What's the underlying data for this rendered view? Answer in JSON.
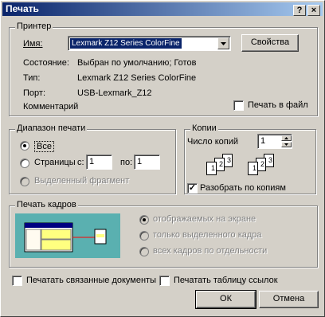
{
  "window": {
    "title": "Печать",
    "help_btn": "?",
    "close_btn": "×"
  },
  "printer": {
    "legend": "Принтер",
    "name_label": "Имя:",
    "name_value": "Lexmark Z12 Series ColorFine",
    "properties_btn": "Свойства",
    "status_label": "Состояние:",
    "status_value": "Выбран по умолчанию; Готов",
    "type_label": "Тип:",
    "type_value": "Lexmark Z12 Series ColorFine",
    "port_label": "Порт:",
    "port_value": "USB-Lexmark_Z12",
    "comment_label": "Комментарий",
    "print_to_file": "Печать в файл"
  },
  "range": {
    "legend": "Диапазон печати",
    "all": "Все",
    "pages": "Страницы",
    "from_label": "с:",
    "from_value": "1",
    "to_label": "по:",
    "to_value": "1",
    "selection": "Выделенный фрагмент"
  },
  "copies": {
    "legend": "Копии",
    "count_label": "Число копий",
    "count_value": "1",
    "collate": "Разобрать по копиям"
  },
  "frames": {
    "legend": "Печать кадров",
    "opt1": "отображаемых на экране",
    "opt2": "только выделенного кадра",
    "opt3": "всех кадров по отдельности"
  },
  "options": {
    "print_linked": "Печатать связанные документы",
    "print_links_table": "Печатать таблицу ссылок"
  },
  "buttons": {
    "ok": "ОК",
    "cancel": "Отмена"
  }
}
